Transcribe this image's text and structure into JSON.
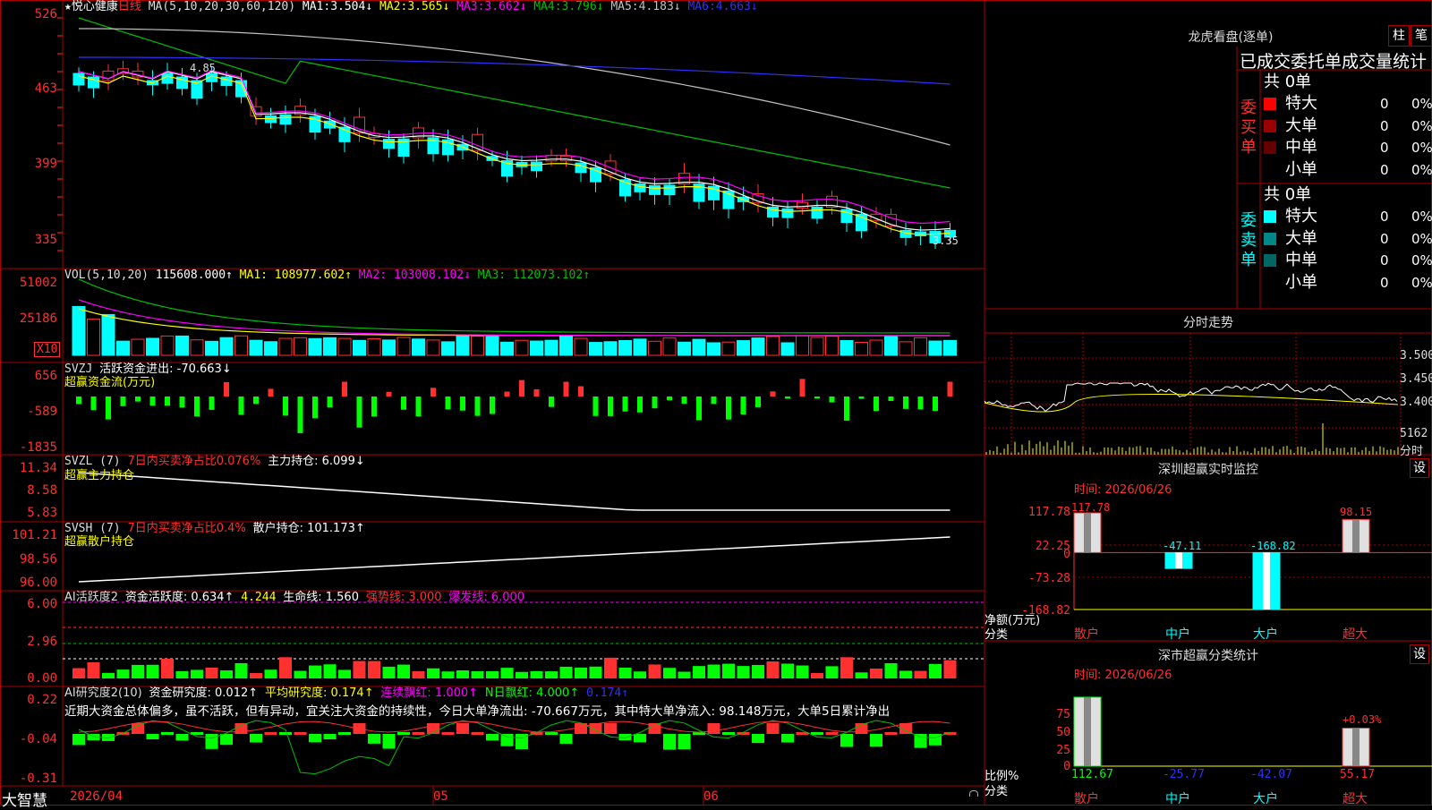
{
  "app": {
    "name": "大智慧"
  },
  "colors": {
    "up": "#ff3030",
    "down": "#00ffff",
    "ma1": "#ffffff",
    "ma2": "#ffff00",
    "ma3": "#ff00ff",
    "ma4": "#00c000",
    "ma5": "#c0c0c0",
    "ma6": "#3030ff",
    "frame": "#aa0000"
  },
  "price_panel": {
    "star": "★",
    "stock_name": "悦心健康",
    "period": "日线",
    "ma_label": "MA(5,10,20,30,60,120)",
    "ma_values": [
      {
        "label": "MA1:",
        "value": "3.504↓"
      },
      {
        "label": "MA2:",
        "value": "3.565↓"
      },
      {
        "label": "MA3:",
        "value": "3.662↓"
      },
      {
        "label": "MA4:",
        "value": "3.796↓"
      },
      {
        "label": "MA5:",
        "value": "4.183↓"
      },
      {
        "label": "MA6:",
        "value": "4.663↓"
      }
    ],
    "y_ticks": [
      "526",
      "463",
      "399",
      "335"
    ],
    "high_marker": "4.85",
    "low_marker": "3.35"
  },
  "vol_panel": {
    "label": "VOL(5,10,20)",
    "value": "115608.000↑",
    "ma1": "MA1: 108977.602↑",
    "ma2": "MA2: 103008.102↓",
    "ma3": "MA3: 112073.102↑",
    "y_ticks": [
      "51002",
      "25186"
    ],
    "unit": "X10"
  },
  "svzj_panel": {
    "label": "SVZJ",
    "title": "活跃资金进出: -70.663↓",
    "subtitle": "超赢资金流(万元)",
    "y_ticks": [
      "656",
      "-589",
      "-1835"
    ]
  },
  "svzl_panel": {
    "label": "SVZL (7)",
    "ratio": "7日内买卖净占比0.076%",
    "holding": "主力持仓: 6.099↓",
    "subtitle": "超赢主力持仓",
    "y_ticks": [
      "11.34",
      "8.58",
      "5.83"
    ]
  },
  "svsh_panel": {
    "label": "SVSH (7)",
    "ratio": "7日内买卖净占比0.4%",
    "holding": "散户持仓: 101.173↑",
    "subtitle": "超赢散户持仓",
    "y_ticks": [
      "101.21",
      "98.56",
      "96.00"
    ]
  },
  "ai_active_panel": {
    "label": "AI活跃度2",
    "v1": "资金活跃度: 0.634↑",
    "v2": "4.244",
    "v3": "生命线: 1.560",
    "v4": "强势线: 3.000",
    "v5": "爆发线: 6.000",
    "y_ticks": [
      "6.00",
      "2.96",
      "0.00"
    ]
  },
  "ai_research_panel": {
    "label": "AI研究度2(10)",
    "v1": "资金研究度: 0.012↑",
    "v2": "平均研究度: 0.174↑",
    "v3": "连续飘红: 1.000↑",
    "v4": "N日飘红: 4.000↑",
    "v5": "0.174↑",
    "commentary": "近期大资金总体偏多，虽不活跃，但有异动，宜关注大资金的持续性，今日大单净流出: -70.667万元，其中特大单净流入: 98.148万元，大单5日累计净出",
    "y_ticks": [
      "0.22",
      "-0.04",
      "-0.31"
    ]
  },
  "date_axis": [
    "2026/04",
    "05",
    "06"
  ],
  "dragon_tiger": {
    "title": "龙虎看盘(逐单)",
    "btn1": "柱",
    "btn2": "笔",
    "section_title": "已成交委托单成交量统计",
    "buy": {
      "side_label": "委买单",
      "total": "共 0单",
      "rows": [
        {
          "name": "特大",
          "count": "0",
          "pct": "0%",
          "color": "#ff0000"
        },
        {
          "name": "大单",
          "count": "0",
          "pct": "0%",
          "color": "#990000"
        },
        {
          "name": "中单",
          "count": "0",
          "pct": "0%",
          "color": "#660000"
        },
        {
          "name": "小单",
          "count": "0",
          "pct": "0%",
          "color": "#000000"
        }
      ]
    },
    "sell": {
      "side_label": "委卖单",
      "total": "共 0单",
      "rows": [
        {
          "name": "特大",
          "count": "0",
          "pct": "0%",
          "color": "#00ffff"
        },
        {
          "name": "大单",
          "count": "0",
          "pct": "0%",
          "color": "#008888"
        },
        {
          "name": "中单",
          "count": "0",
          "pct": "0%",
          "color": "#006666"
        },
        {
          "name": "小单",
          "count": "0",
          "pct": "0%",
          "color": "#000000"
        }
      ]
    }
  },
  "intraday": {
    "title": "分时走势",
    "y_ticks": [
      "3.500",
      "3.450",
      "3.400"
    ],
    "vol_value": "5162",
    "vol_label": "分时"
  },
  "sz_monitor": {
    "title": "深圳超赢实时监控",
    "settings": "设",
    "time": "时间: 2026/06/26",
    "y_ticks": [
      "117.78",
      "22.25",
      "0",
      "-73.28",
      "-168.82"
    ],
    "y_unit": "净额(万元)",
    "x_unit": "分类",
    "categories": [
      "散户",
      "中户",
      "大户",
      "超大"
    ],
    "values": [
      117.78,
      -47.11,
      -168.82,
      98.15
    ],
    "value_labels": [
      "117.78",
      "-47.11",
      "-168.82",
      "98.15"
    ]
  },
  "sz_classify": {
    "title": "深市超赢分类统计",
    "settings": "设",
    "time": "时间: 2026/06/26",
    "y_ticks": [
      "75",
      "50",
      "25",
      "0"
    ],
    "y_unit": "比例%",
    "x_unit": "分类",
    "categories": [
      "散户",
      "中户",
      "大户",
      "超大"
    ],
    "values": [
      112.67,
      -25.77,
      -42.07,
      55.17
    ],
    "value_labels": [
      "112.67",
      "-25.77",
      "-42.07",
      "55.17"
    ],
    "annotation": "+0.03%"
  },
  "chart_data": {
    "type": "bar",
    "title": "深圳超赢实时监控",
    "categories": [
      "散户",
      "中户",
      "大户",
      "超大"
    ],
    "values": [
      117.78,
      -47.11,
      -168.82,
      98.15
    ],
    "ylabel": "净额(万元)",
    "xlabel": "分类",
    "ylim": [
      -168.82,
      117.78
    ]
  }
}
